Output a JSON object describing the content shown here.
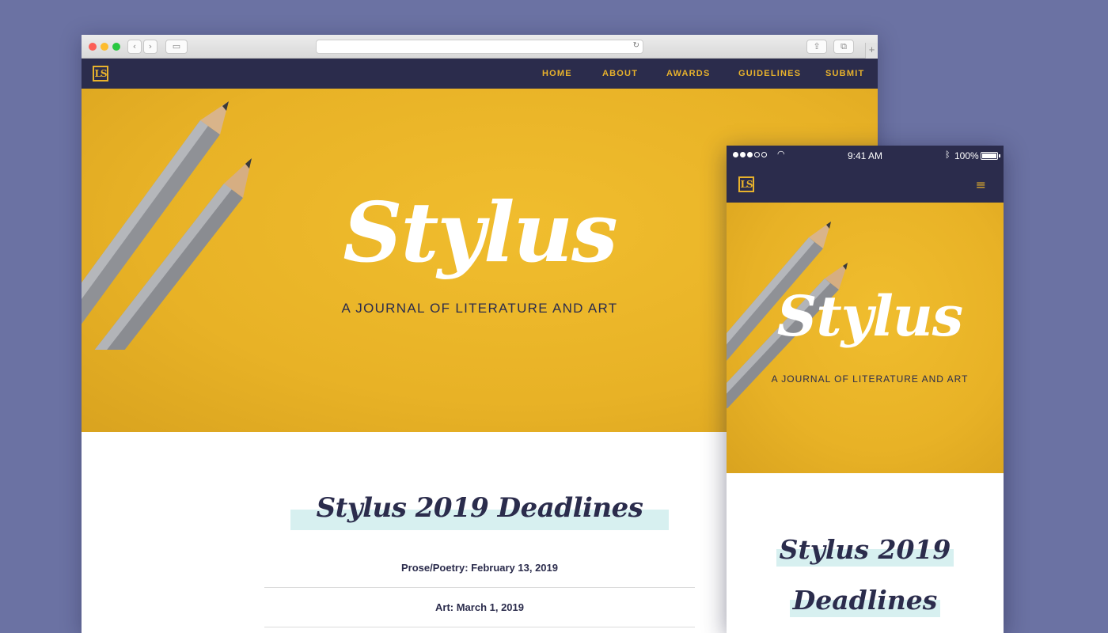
{
  "desktop": {
    "logo_text": "LS",
    "nav": [
      "HOME",
      "ABOUT",
      "AWARDS",
      "GUIDELINES",
      "SUBMIT"
    ],
    "hero": {
      "title": "Stylus",
      "subtitle": "A JOURNAL OF LITERATURE AND ART"
    },
    "deadlines": {
      "heading": "Stylus 2019 Deadlines",
      "rows": [
        "Prose/Poetry: February 13, 2019",
        "Art: March 1, 2019"
      ]
    }
  },
  "mobile": {
    "status": {
      "time": "9:41 AM",
      "battery": "100%",
      "battery_level": 1.0
    },
    "logo_text": "LS",
    "menu_icon": "≡",
    "hero": {
      "title": "Stylus",
      "subtitle": "A JOURNAL OF LITERATURE AND ART"
    },
    "deadlines": {
      "heading_line1": "Stylus 2019",
      "heading_line2": "Deadlines"
    }
  },
  "colors": {
    "navy": "#2b2c4c",
    "gold": "#e8b22c",
    "highlight": "#d7f0f0",
    "background": "#6b72a3"
  }
}
